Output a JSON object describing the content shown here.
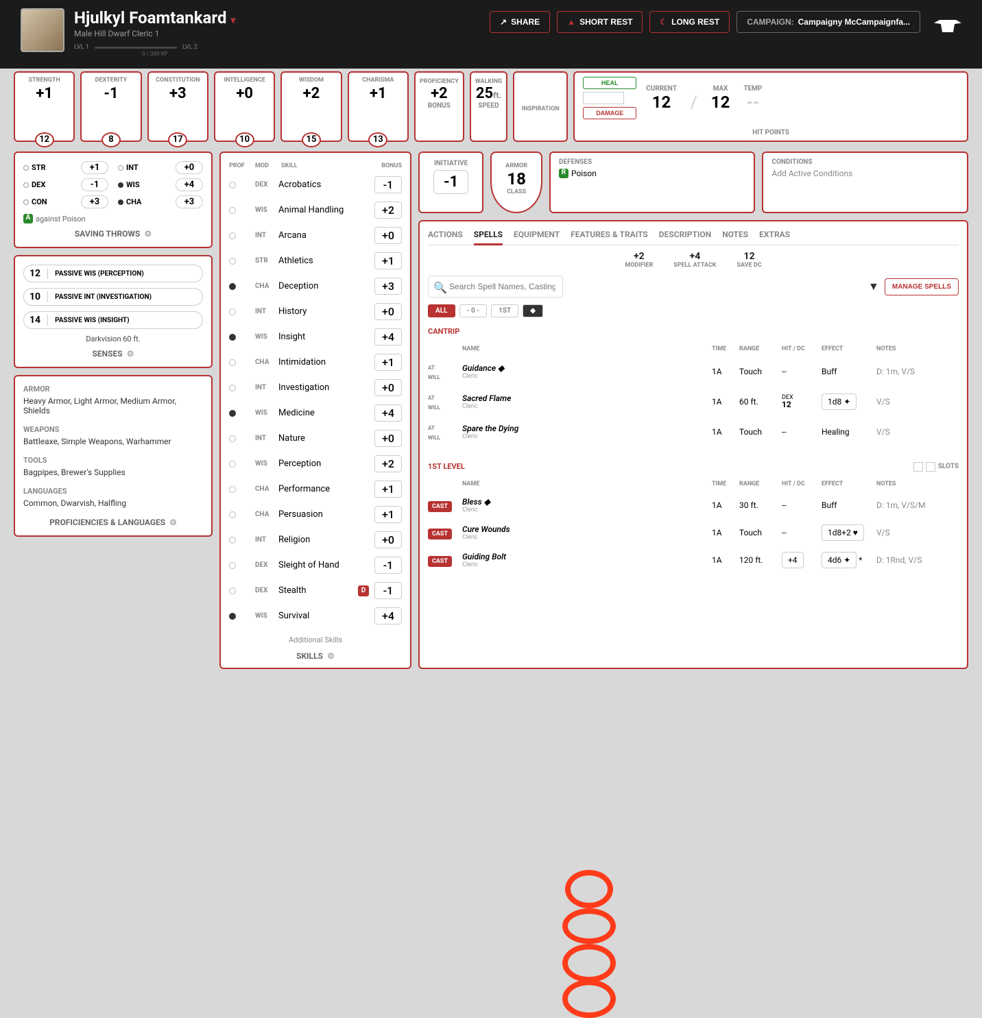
{
  "character": {
    "name": "Hjulkyl Foamtankard",
    "subtitle": "Male Hill Dwarf Cleric 1",
    "xp": "0 / 300 XP",
    "lvl_left": "LVL 1",
    "lvl_right": "LVL 2"
  },
  "header": {
    "share": "SHARE",
    "short_rest": "SHORT REST",
    "long_rest": "LONG REST",
    "campaign_label": "CAMPAIGN:",
    "campaign": "Campaigny McCampaignfa..."
  },
  "abilities": [
    {
      "label": "STRENGTH",
      "mod": "+1",
      "score": "12"
    },
    {
      "label": "DEXTERITY",
      "mod": "-1",
      "score": "8"
    },
    {
      "label": "CONSTITUTION",
      "mod": "+3",
      "score": "17"
    },
    {
      "label": "INTELLIGENCE",
      "mod": "+0",
      "score": "10"
    },
    {
      "label": "WISDOM",
      "mod": "+2",
      "score": "15"
    },
    {
      "label": "CHARISMA",
      "mod": "+1",
      "score": "13"
    }
  ],
  "proficiency": {
    "label": "PROFICIENCY",
    "val": "+2",
    "sub": "BONUS"
  },
  "speed": {
    "label": "WALKING",
    "val": "25",
    "unit": "ft.",
    "sub": "SPEED"
  },
  "inspiration": {
    "label": "INSPIRATION"
  },
  "hp": {
    "heal": "HEAL",
    "damage": "DAMAGE",
    "current_l": "CURRENT",
    "current": "12",
    "max_l": "MAX",
    "max": "12",
    "temp_l": "TEMP",
    "temp": "--",
    "foot": "HIT POINTS"
  },
  "initiative": {
    "label": "INITIATIVE",
    "val": "-1"
  },
  "ac": {
    "l1": "ARMOR",
    "val": "18",
    "l2": "CLASS"
  },
  "defenses": {
    "label": "DEFENSES",
    "item": "Poison"
  },
  "conditions": {
    "label": "CONDITIONS",
    "placeholder": "Add Active Conditions"
  },
  "saves": {
    "title": "SAVING THROWS",
    "items": [
      {
        "abv": "STR",
        "val": "+1",
        "prof": false
      },
      {
        "abv": "INT",
        "val": "+0",
        "prof": false
      },
      {
        "abv": "DEX",
        "val": "-1",
        "prof": false
      },
      {
        "abv": "WIS",
        "val": "+4",
        "prof": true
      },
      {
        "abv": "CON",
        "val": "+3",
        "prof": false
      },
      {
        "abv": "CHA",
        "val": "+3",
        "prof": true
      }
    ],
    "advantage": "against Poison"
  },
  "senses": {
    "title": "SENSES",
    "rows": [
      {
        "score": "12",
        "name": "PASSIVE WIS (PERCEPTION)"
      },
      {
        "score": "10",
        "name": "PASSIVE INT (INVESTIGATION)"
      },
      {
        "score": "14",
        "name": "PASSIVE WIS (INSIGHT)"
      }
    ],
    "extra": "Darkvision 60 ft."
  },
  "profs": {
    "title": "PROFICIENCIES & LANGUAGES",
    "armor_h": "ARMOR",
    "armor": "Heavy Armor, Light Armor, Medium Armor, Shields",
    "weapons_h": "WEAPONS",
    "weapons": "Battleaxe, Simple Weapons, Warhammer",
    "tools_h": "TOOLS",
    "tools": "Bagpipes, Brewer's Supplies",
    "langs_h": "LANGUAGES",
    "langs": "Common, Dwarvish, Halfling"
  },
  "skills": {
    "title": "SKILLS",
    "head": {
      "prof": "PROF",
      "mod": "MOD",
      "skill": "SKILL",
      "bonus": "BONUS"
    },
    "add": "Additional Skills",
    "rows": [
      {
        "prof": false,
        "mod": "DEX",
        "name": "Acrobatics",
        "bonus": "-1"
      },
      {
        "prof": false,
        "mod": "WIS",
        "name": "Animal Handling",
        "bonus": "+2"
      },
      {
        "prof": false,
        "mod": "INT",
        "name": "Arcana",
        "bonus": "+0"
      },
      {
        "prof": false,
        "mod": "STR",
        "name": "Athletics",
        "bonus": "+1"
      },
      {
        "prof": true,
        "mod": "CHA",
        "name": "Deception",
        "bonus": "+3"
      },
      {
        "prof": false,
        "mod": "INT",
        "name": "History",
        "bonus": "+0"
      },
      {
        "prof": true,
        "mod": "WIS",
        "name": "Insight",
        "bonus": "+4"
      },
      {
        "prof": false,
        "mod": "CHA",
        "name": "Intimidation",
        "bonus": "+1"
      },
      {
        "prof": false,
        "mod": "INT",
        "name": "Investigation",
        "bonus": "+0"
      },
      {
        "prof": true,
        "mod": "WIS",
        "name": "Medicine",
        "bonus": "+4"
      },
      {
        "prof": false,
        "mod": "INT",
        "name": "Nature",
        "bonus": "+0"
      },
      {
        "prof": false,
        "mod": "WIS",
        "name": "Perception",
        "bonus": "+2"
      },
      {
        "prof": false,
        "mod": "CHA",
        "name": "Performance",
        "bonus": "+1"
      },
      {
        "prof": false,
        "mod": "CHA",
        "name": "Persuasion",
        "bonus": "+1"
      },
      {
        "prof": false,
        "mod": "INT",
        "name": "Religion",
        "bonus": "+0"
      },
      {
        "prof": false,
        "mod": "DEX",
        "name": "Sleight of Hand",
        "bonus": "-1"
      },
      {
        "prof": false,
        "mod": "DEX",
        "name": "Stealth",
        "bonus": "-1",
        "disadvantage": true
      },
      {
        "prof": true,
        "mod": "WIS",
        "name": "Survival",
        "bonus": "+4"
      }
    ]
  },
  "tabs": [
    "ACTIONS",
    "SPELLS",
    "EQUIPMENT",
    "FEATURES & TRAITS",
    "DESCRIPTION",
    "NOTES",
    "EXTRAS"
  ],
  "active_tab": "SPELLS",
  "spell_stats": {
    "mod_l": "MODIFIER",
    "mod": "+2",
    "atk_l": "SPELL ATTACK",
    "atk": "+4",
    "dc_l": "SAVE DC",
    "dc": "12"
  },
  "search": {
    "placeholder": "Search Spell Names, Casting Times, Damage Types, Conditions or Tags",
    "manage": "MANAGE SPELLS"
  },
  "filters": [
    "ALL",
    "- 0 -",
    "1ST"
  ],
  "cantrip_h": "CANTRIP",
  "sp_head": {
    "name": "NAME",
    "time": "TIME",
    "range": "RANGE",
    "hit": "HIT / DC",
    "effect": "EFFECT",
    "notes": "NOTES"
  },
  "cantrips": [
    {
      "action": "AT WILL",
      "name": "Guidance",
      "src": "Cleric",
      "time": "1A",
      "range": "Touch",
      "hit": "--",
      "effect": "Buff",
      "notes": "D: 1m, V/S",
      "conc": true
    },
    {
      "action": "AT WILL",
      "name": "Sacred Flame",
      "src": "Cleric",
      "time": "1A",
      "range": "60 ft.",
      "hit": "DEX 12",
      "effect": "1d8 ✦",
      "notes": "V/S"
    },
    {
      "action": "AT WILL",
      "name": "Spare the Dying",
      "src": "Cleric",
      "time": "1A",
      "range": "Touch",
      "hit": "--",
      "effect": "Healing",
      "notes": "V/S"
    }
  ],
  "lvl1_h": "1ST LEVEL",
  "slots_label": "SLOTS",
  "lvl1": [
    {
      "action": "CAST",
      "name": "Bless",
      "src": "Cleric",
      "time": "1A",
      "range": "30 ft.",
      "hit": "--",
      "effect": "Buff",
      "notes": "D: 1m, V/S/M",
      "conc": true
    },
    {
      "action": "CAST",
      "name": "Cure Wounds",
      "src": "Cleric",
      "time": "1A",
      "range": "Touch",
      "hit": "--",
      "effect": "1d8+2 ♥",
      "notes": "V/S"
    },
    {
      "action": "CAST",
      "name": "Guiding Bolt",
      "src": "Cleric",
      "time": "1A",
      "range": "120 ft.",
      "hit": "+4",
      "effect": "4d6 ✦",
      "star": "*",
      "notes": "D: 1Rnd, V/S"
    }
  ]
}
